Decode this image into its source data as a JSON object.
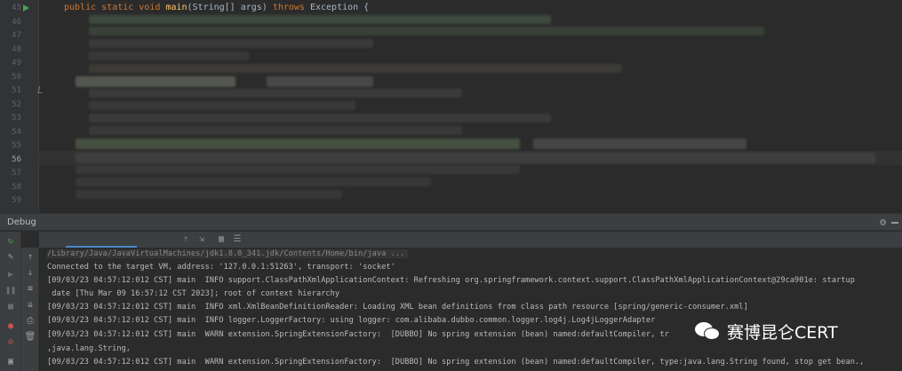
{
  "editor": {
    "line_numbers": [
      "45",
      "46",
      "47",
      "48",
      "49",
      "50",
      "51",
      "52",
      "53",
      "54",
      "55",
      "56",
      "57",
      "58",
      "59"
    ],
    "current_line": "56",
    "code": {
      "kw1": "public static void ",
      "method": "main",
      "args": "(String[] args) ",
      "throws": "throws ",
      "exc": "Exception {"
    },
    "marker_text": "L"
  },
  "debug": {
    "title": "Debug",
    "settings_icon": "gear-icon",
    "minimize_icon": "minimize-icon"
  },
  "console": {
    "lines": [
      "/Library/Java/JavaVirtualMachines/jdk1.8.0_341.jdk/Contents/Home/bin/java ...",
      "Connected to the target VM, address: '127.0.0.1:51263', transport: 'socket'",
      "[09/03/23 04:57:12:012 CST] main  INFO support.ClassPathXmlApplicationContext: Refreshing org.springframework.context.support.ClassPathXmlApplicationContext@29ca901e: startup",
      " date [Thu Mar 09 16:57:12 CST 2023]; root of context hierarchy",
      "[09/03/23 04:57:12:012 CST] main  INFO xml.XmlBeanDefinitionReader: Loading XML bean definitions from class path resource [spring/generic-consumer.xml]",
      "[09/03/23 04:57:12:012 CST] main  INFO logger.LoggerFactory: using logger: com.alibaba.dubbo.common.logger.log4j.Log4jLoggerAdapter",
      "[09/03/23 04:57:12:012 CST] main  WARN extension.SpringExtensionFactory:  [DUBBO] No spring extension (bean) named:defaultCompiler, tr",
      ",java.lang.String,",
      "[09/03/23 04:57:12:012 CST] main  WARN extension.SpringExtensionFactory:  [DUBBO] No spring extension (bean) named:defaultCompiler, type:java.lang.String found, stop get bean.,"
    ]
  },
  "watermark": {
    "text": "赛博昆仑CERT"
  },
  "colors": {
    "keyword": "#cc7832",
    "method": "#ffc66d",
    "background": "#2b2b2b",
    "panel": "#3c3f41"
  }
}
